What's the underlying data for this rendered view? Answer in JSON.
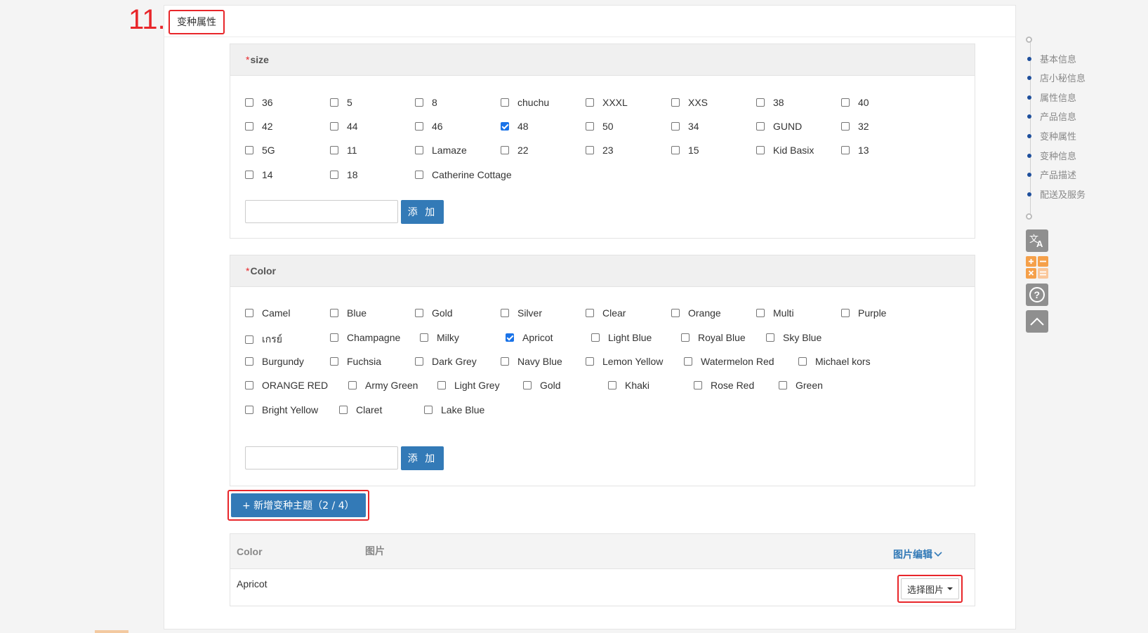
{
  "step_number": "11.",
  "section_title": "变种属性",
  "size_panel": {
    "required_mark": "*",
    "title": "size",
    "options": [
      {
        "label": "36",
        "checked": false
      },
      {
        "label": "5",
        "checked": false
      },
      {
        "label": "8",
        "checked": false
      },
      {
        "label": "chuchu",
        "checked": false
      },
      {
        "label": "XXXL",
        "checked": false
      },
      {
        "label": "XXS",
        "checked": false
      },
      {
        "label": "38",
        "checked": false
      },
      {
        "label": "40",
        "checked": false
      },
      {
        "label": "42",
        "checked": false
      },
      {
        "label": "44",
        "checked": false
      },
      {
        "label": "46",
        "checked": false
      },
      {
        "label": "48",
        "checked": true
      },
      {
        "label": "50",
        "checked": false
      },
      {
        "label": "34",
        "checked": false
      },
      {
        "label": "GUND",
        "checked": false
      },
      {
        "label": "32",
        "checked": false
      },
      {
        "label": "5G",
        "checked": false
      },
      {
        "label": "11",
        "checked": false
      },
      {
        "label": "Lamaze",
        "checked": false
      },
      {
        "label": "22",
        "checked": false
      },
      {
        "label": "23",
        "checked": false
      },
      {
        "label": "15",
        "checked": false
      },
      {
        "label": "Kid Basix",
        "checked": false
      },
      {
        "label": "13",
        "checked": false
      },
      {
        "label": "14",
        "checked": false
      },
      {
        "label": "18",
        "checked": false
      },
      {
        "label": "Catherine Cottage",
        "checked": false
      }
    ],
    "input_value": "",
    "add_label": "添 加"
  },
  "color_panel": {
    "required_mark": "*",
    "title": "Color",
    "options": [
      {
        "label": "Camel",
        "checked": false
      },
      {
        "label": "Blue",
        "checked": false
      },
      {
        "label": "Gold",
        "checked": false
      },
      {
        "label": "Silver",
        "checked": false
      },
      {
        "label": "Clear",
        "checked": false
      },
      {
        "label": "Orange",
        "checked": false
      },
      {
        "label": "Multi",
        "checked": false
      },
      {
        "label": "Purple",
        "checked": false
      },
      {
        "label": "เกรย์",
        "checked": false
      },
      {
        "label": "Champagne",
        "checked": false
      },
      {
        "label": "Milky",
        "checked": false
      },
      {
        "label": "Apricot",
        "checked": true
      },
      {
        "label": "Light Blue",
        "checked": false
      },
      {
        "label": "Royal Blue",
        "checked": false
      },
      {
        "label": "Sky Blue",
        "checked": false
      },
      {
        "label": "Burgundy",
        "checked": false
      },
      {
        "label": "Fuchsia",
        "checked": false
      },
      {
        "label": "Dark Grey",
        "checked": false
      },
      {
        "label": "Navy Blue",
        "checked": false
      },
      {
        "label": "Lemon Yellow",
        "checked": false
      },
      {
        "label": "Watermelon Red",
        "checked": false
      },
      {
        "label": "Michael kors",
        "checked": false
      },
      {
        "label": "ORANGE RED",
        "checked": false
      },
      {
        "label": "Army Green",
        "checked": false
      },
      {
        "label": "Light Grey",
        "checked": false
      },
      {
        "label": "Gold",
        "checked": false
      },
      {
        "label": "Khaki",
        "checked": false
      },
      {
        "label": "Rose Red",
        "checked": false
      },
      {
        "label": "Green",
        "checked": false
      },
      {
        "label": "Bright Yellow",
        "checked": false
      },
      {
        "label": "Claret",
        "checked": false
      },
      {
        "label": "Lake Blue",
        "checked": false
      }
    ],
    "input_value": "",
    "add_label": "添 加"
  },
  "new_theme_button": "+ 新增变种主题（2 / 4）",
  "variant_table": {
    "col_color": "Color",
    "col_image": "图片",
    "image_edit": "图片编辑",
    "rows": [
      {
        "color": "Apricot",
        "pick_image": "选择图片"
      }
    ]
  },
  "side_nav": {
    "items": [
      "基本信息",
      "店小秘信息",
      "属性信息",
      "产品信息",
      "变种属性",
      "变种信息",
      "产品描述",
      "配送及服务"
    ]
  },
  "tools": [
    "translate-icon",
    "calculator-icon",
    "help-icon",
    "back-to-top-icon"
  ],
  "colors": {
    "primary_blue": "#337ab7",
    "highlight_red": "#e8262a",
    "nav_dot": "#1e4f9c",
    "calculator_orange": "#f5a04a"
  }
}
